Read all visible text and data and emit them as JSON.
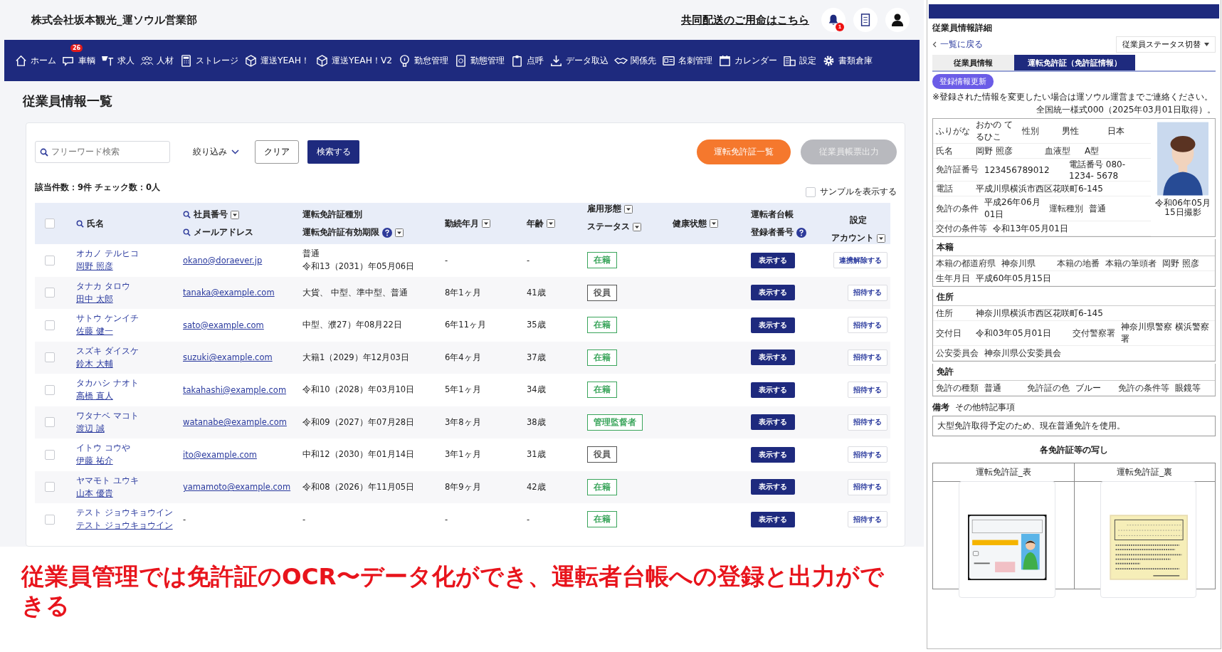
{
  "header": {
    "company": "株式会社坂本観光_運ソウル営業部",
    "link": "共同配送のご用命はこちら",
    "bell_badge": "1"
  },
  "nav": [
    {
      "label": "ホーム"
    },
    {
      "label": "車輌",
      "badge": "26"
    },
    {
      "label": "求人"
    },
    {
      "label": "人材"
    },
    {
      "label": "ストレージ"
    },
    {
      "label": "運送YEAH！"
    },
    {
      "label": "運送YEAH！V2"
    },
    {
      "label": "勤怠管理"
    },
    {
      "label": "勤態管理"
    },
    {
      "label": "点呼"
    },
    {
      "label": "データ取込"
    },
    {
      "label": "関係先"
    },
    {
      "label": "名刺管理"
    },
    {
      "label": "カレンダー"
    },
    {
      "label": "設定"
    },
    {
      "label": "書類倉庫"
    }
  ],
  "page_title": "従業員情報一覧",
  "toolbar": {
    "search_placeholder": "フリーワード検索",
    "filter": "絞り込み",
    "clear": "クリア",
    "search": "検索する",
    "license_list": "運転免許証一覧",
    "export": "従業員帳票出力",
    "export_disabled": true
  },
  "summary": "該当件数：9件 チェック数：0人",
  "sample_toggle": {
    "label": "サンプルを表示する",
    "checked": false
  },
  "table": {
    "select_all_checked": false,
    "columns": [
      {
        "lines": [
          {
            "text": "氏名",
            "kind": "search"
          }
        ]
      },
      {
        "lines": [
          {
            "text": "社員番号",
            "kind": "search_sort"
          },
          {
            "text": "メールアドレス",
            "kind": "search"
          }
        ]
      },
      {
        "lines": [
          {
            "text": "運転免許証種別",
            "kind": "plain"
          },
          {
            "text": "運転免許証有効期限",
            "kind": "help_sort"
          }
        ]
      },
      {
        "lines": [
          {
            "text": "勤続年月",
            "kind": "sort"
          }
        ]
      },
      {
        "lines": [
          {
            "text": "年齢",
            "kind": "sort"
          }
        ]
      },
      {
        "lines": [
          {
            "text": "雇用形態",
            "kind": "sort"
          },
          {
            "text": "ステータス",
            "kind": "sort"
          }
        ]
      },
      {
        "lines": [
          {
            "text": "健康状態",
            "kind": "sort"
          }
        ]
      },
      {
        "lines": [
          {
            "text": "運転者台帳",
            "kind": "plain"
          },
          {
            "text": "登録者番号",
            "kind": "help"
          }
        ]
      },
      {
        "lines": [
          {
            "text": "設定",
            "kind": "plain"
          },
          {
            "text": "アカウント",
            "kind": "sort"
          }
        ]
      }
    ],
    "rows": [
      {
        "checked": false,
        "kana": "オカノ テルヒコ",
        "name": "岡野 照彦",
        "email": "okano@doraever.jp",
        "license": [
          "普通",
          "令和13（2031）年05月06日"
        ],
        "tenure": "-",
        "age": "-",
        "status": {
          "label": "在籍",
          "color": "#3aa55b"
        },
        "view": "表示する",
        "account": "連携解除する"
      },
      {
        "checked": false,
        "kana": "タナカ タロウ",
        "name": "田中 太郎",
        "email": "tanaka@example.com",
        "license": [
          "大貨、 中型、準中型、普通"
        ],
        "tenure": "8年1ヶ月",
        "age": "41歳",
        "status": {
          "label": "役員",
          "color": "#555555"
        },
        "view": "表示する",
        "account": "招待する"
      },
      {
        "checked": false,
        "kana": "サトウ ケンイチ",
        "name": "佐藤 健一",
        "email": "sato@example.com",
        "license": [
          "中型、濮27）年08月22日"
        ],
        "tenure": "6年11ヶ月",
        "age": "35歳",
        "status": {
          "label": "在籍",
          "color": "#3aa55b"
        },
        "view": "表示する",
        "account": "招待する"
      },
      {
        "checked": false,
        "kana": "スズキ ダイスケ",
        "name": "鈴木 大輔",
        "email": "suzuki@example.com",
        "license": [
          "大籍1（2029）年12月03日"
        ],
        "tenure": "6年4ヶ月",
        "age": "37歳",
        "status": {
          "label": "在籍",
          "color": "#3aa55b"
        },
        "view": "表示する",
        "account": "招待する"
      },
      {
        "checked": false,
        "kana": "タカハシ ナオト",
        "name": "高橋 直人",
        "email": "takahashi@example.com",
        "license": [
          "令和10（2028）年03月10日"
        ],
        "tenure": "5年1ヶ月",
        "age": "34歳",
        "status": {
          "label": "在籍",
          "color": "#3aa55b"
        },
        "view": "表示する",
        "account": "招待する"
      },
      {
        "checked": false,
        "kana": "ワタナベ マコト",
        "name": "渡辺 誠",
        "email": "watanabe@example.com",
        "license": [
          "令和09（2027）年07月28日"
        ],
        "tenure": "3年8ヶ月",
        "age": "38歳",
        "status": {
          "label": "管理監督者",
          "color": "#3aa55b"
        },
        "view": "表示する",
        "account": "招待する"
      },
      {
        "checked": false,
        "kana": "イトウ コウや",
        "name": "伊藤 祐介",
        "email": "ito@example.com",
        "license": [
          "中和12（2030）年01月14日"
        ],
        "tenure": "3年1ヶ月",
        "age": "31歳",
        "status": {
          "label": "役員",
          "color": "#555555"
        },
        "view": "表示する",
        "account": "招待する"
      },
      {
        "checked": false,
        "kana": "ヤマモト ユウキ",
        "name": "山本 優貴",
        "email": "yamamoto@example.com",
        "license": [
          "令和08（2026）年11月05日"
        ],
        "tenure": "8年9ヶ月",
        "age": "42歳",
        "status": {
          "label": "在籍",
          "color": "#3aa55b"
        },
        "view": "表示する",
        "account": "招待する"
      },
      {
        "checked": false,
        "kana": "テスト ジョウキョウイン",
        "name": "テスト ジョウキョウイン",
        "email": "-",
        "license": [
          "-"
        ],
        "tenure": "-",
        "age": "-",
        "status": {
          "label": "在籍",
          "color": "#3aa55b"
        },
        "view": "表示する",
        "account": "招待する"
      }
    ]
  },
  "caption": "従業員管理では免許証のOCR〜データ化ができ、運転者台帳への登録と出力ができる",
  "inset": {
    "title": "従業員情報詳細",
    "back_link": "一覧に戻る",
    "status_menu": "従業員ステータス切替",
    "tabs": [
      {
        "label": "従業員情報",
        "selected": false
      },
      {
        "label": "運転免許証（免許証情報）",
        "selected": true
      }
    ],
    "update_button": "登録情報更新",
    "notice": "※登録された情報を変更したい場合は運ソウル運営までご連絡ください。",
    "form_note": "全国統一様式000（2025年03月01日取得）。",
    "basic_rows": [
      [
        {
          "kind": "label",
          "text": "ふりがな"
        },
        {
          "kind": "value",
          "text": "おかの てるひこ"
        },
        {
          "kind": "label",
          "text": "性別"
        },
        {
          "kind": "value",
          "text": "男性"
        },
        {
          "kind": "value",
          "text": "日本"
        }
      ],
      [
        {
          "kind": "label",
          "text": "氏名"
        },
        {
          "kind": "value",
          "text": "岡野 照彦"
        },
        {
          "kind": "label",
          "text": "血液型"
        },
        {
          "kind": "value",
          "text": "A型"
        }
      ],
      [
        {
          "kind": "label",
          "text": "免許証番号"
        },
        {
          "kind": "value",
          "text": "123456789012"
        },
        {
          "kind": "value",
          "text": "電話番号 080-1234- 5678"
        }
      ],
      [
        {
          "kind": "label",
          "text": "電話"
        },
        {
          "kind": "value",
          "text": "平成川県横浜市西区花咲町6-145"
        }
      ],
      [
        {
          "kind": "label",
          "text": "免許の条件"
        },
        {
          "kind": "value",
          "text": "平成26年06月01日"
        },
        {
          "kind": "label",
          "text": "運転種別"
        },
        {
          "kind": "value",
          "text": "普通"
        }
      ],
      [
        {
          "kind": "label",
          "text": "交付の条件等"
        },
        {
          "kind": "value",
          "text": "令和13年05月01日"
        }
      ]
    ],
    "photo_caption": "令和06年05月15日撮影",
    "sections": [
      {
        "title": "本籍",
        "rows": [
          [
            {
              "kind": "label",
              "text": "本籍の都道府県"
            },
            {
              "kind": "value",
              "text": "神奈川県"
            },
            {
              "kind": "label",
              "text": "本籍の地番"
            },
            {
              "kind": "label",
              "text": "本籍の筆頭者"
            },
            {
              "kind": "value",
              "text": "岡野 照彦"
            }
          ],
          [
            {
              "kind": "label",
              "text": "生年月日"
            },
            {
              "kind": "value",
              "text": "平成60年05月15日"
            }
          ]
        ]
      },
      {
        "title": "住所",
        "rows": [
          [
            {
              "kind": "label",
              "text": "住所"
            },
            {
              "kind": "value",
              "text": "神奈川県横浜市西区花咲町6-145"
            }
          ],
          [
            {
              "kind": "label",
              "text": "交付日"
            },
            {
              "kind": "value",
              "text": "令和03年05月01日"
            },
            {
              "kind": "label",
              "text": "交付警察署"
            },
            {
              "kind": "value",
              "text": "神奈川県警察 横浜警察署"
            }
          ],
          [
            {
              "kind": "label",
              "text": "公安委員会"
            },
            {
              "kind": "value",
              "text": "神奈川県公安委員会"
            }
          ]
        ]
      },
      {
        "title": "免許",
        "rows": [
          [
            {
              "kind": "label",
              "text": "免許の種類"
            },
            {
              "kind": "value",
              "text": "普通"
            },
            {
              "kind": "label",
              "text": "免許証の色"
            },
            {
              "kind": "value",
              "text": "ブルー"
            },
            {
              "kind": "label",
              "text": "免許の条件等"
            },
            {
              "kind": "value",
              "text": "眼鏡等"
            }
          ]
        ]
      }
    ],
    "remarks_title": "備考",
    "remarks_subtitle": "その他特記事項",
    "remarks_text": "大型免許取得予定のため、現在普通免許を使用。",
    "copies_title": "各免許証等の写し",
    "copies": [
      {
        "label": "運転免許証_表",
        "kind": "picture"
      },
      {
        "label": "運転免許証_裏",
        "kind": "picture"
      }
    ]
  }
}
